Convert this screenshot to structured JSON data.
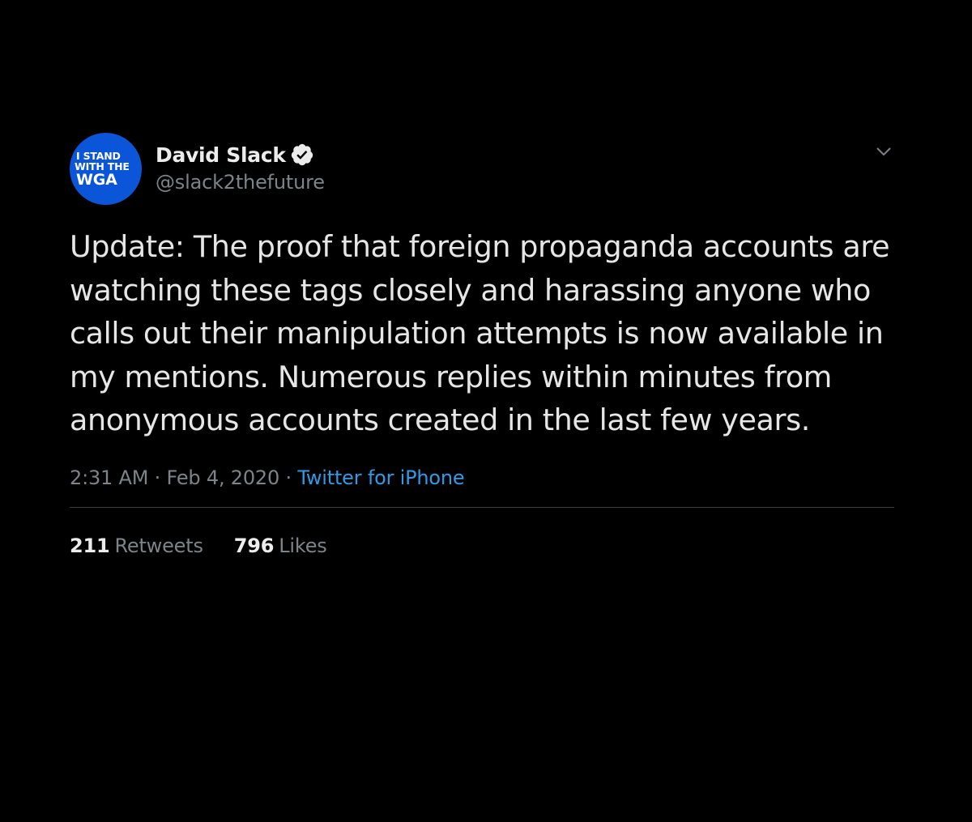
{
  "tweet": {
    "avatar": {
      "line1": "I STAND",
      "line2": "WITH THE",
      "line3": "WGA",
      "color": "#0a55d8"
    },
    "display_name": "David Slack",
    "handle": "@slack2thefuture",
    "verified_icon": "verified-badge-icon",
    "menu_icon": "chevron-down-icon",
    "text": "Update: The proof that foreign propaganda accounts are watching these tags closely and harassing anyone who calls out their manipulation attempts is now available in my mentions. Numerous replies within minutes from anonymous accounts created in the last few years.",
    "time": "2:31 AM",
    "separator1": " · ",
    "date": "Feb 4, 2020",
    "separator2": " · ",
    "source": "Twitter for iPhone",
    "source_color": "#2f9ae6",
    "retweets_count": "211",
    "retweets_label": "Retweets",
    "likes_count": "796",
    "likes_label": "Likes"
  },
  "colors": {
    "background": "#000000",
    "text_primary": "#e6e6e6",
    "text_secondary": "#7d8388"
  }
}
